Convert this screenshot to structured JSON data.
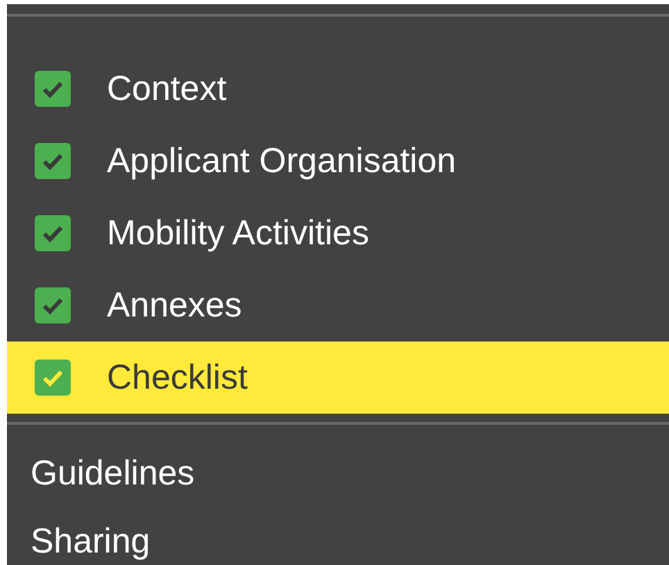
{
  "sections": [
    {
      "label": "Context",
      "checked": true,
      "selected": false
    },
    {
      "label": "Applicant Organisation",
      "checked": true,
      "selected": false
    },
    {
      "label": "Mobility Activities",
      "checked": true,
      "selected": false
    },
    {
      "label": "Annexes",
      "checked": true,
      "selected": false
    },
    {
      "label": "Checklist",
      "checked": true,
      "selected": true
    }
  ],
  "links": [
    {
      "label": "Guidelines"
    },
    {
      "label": "Sharing"
    }
  ]
}
